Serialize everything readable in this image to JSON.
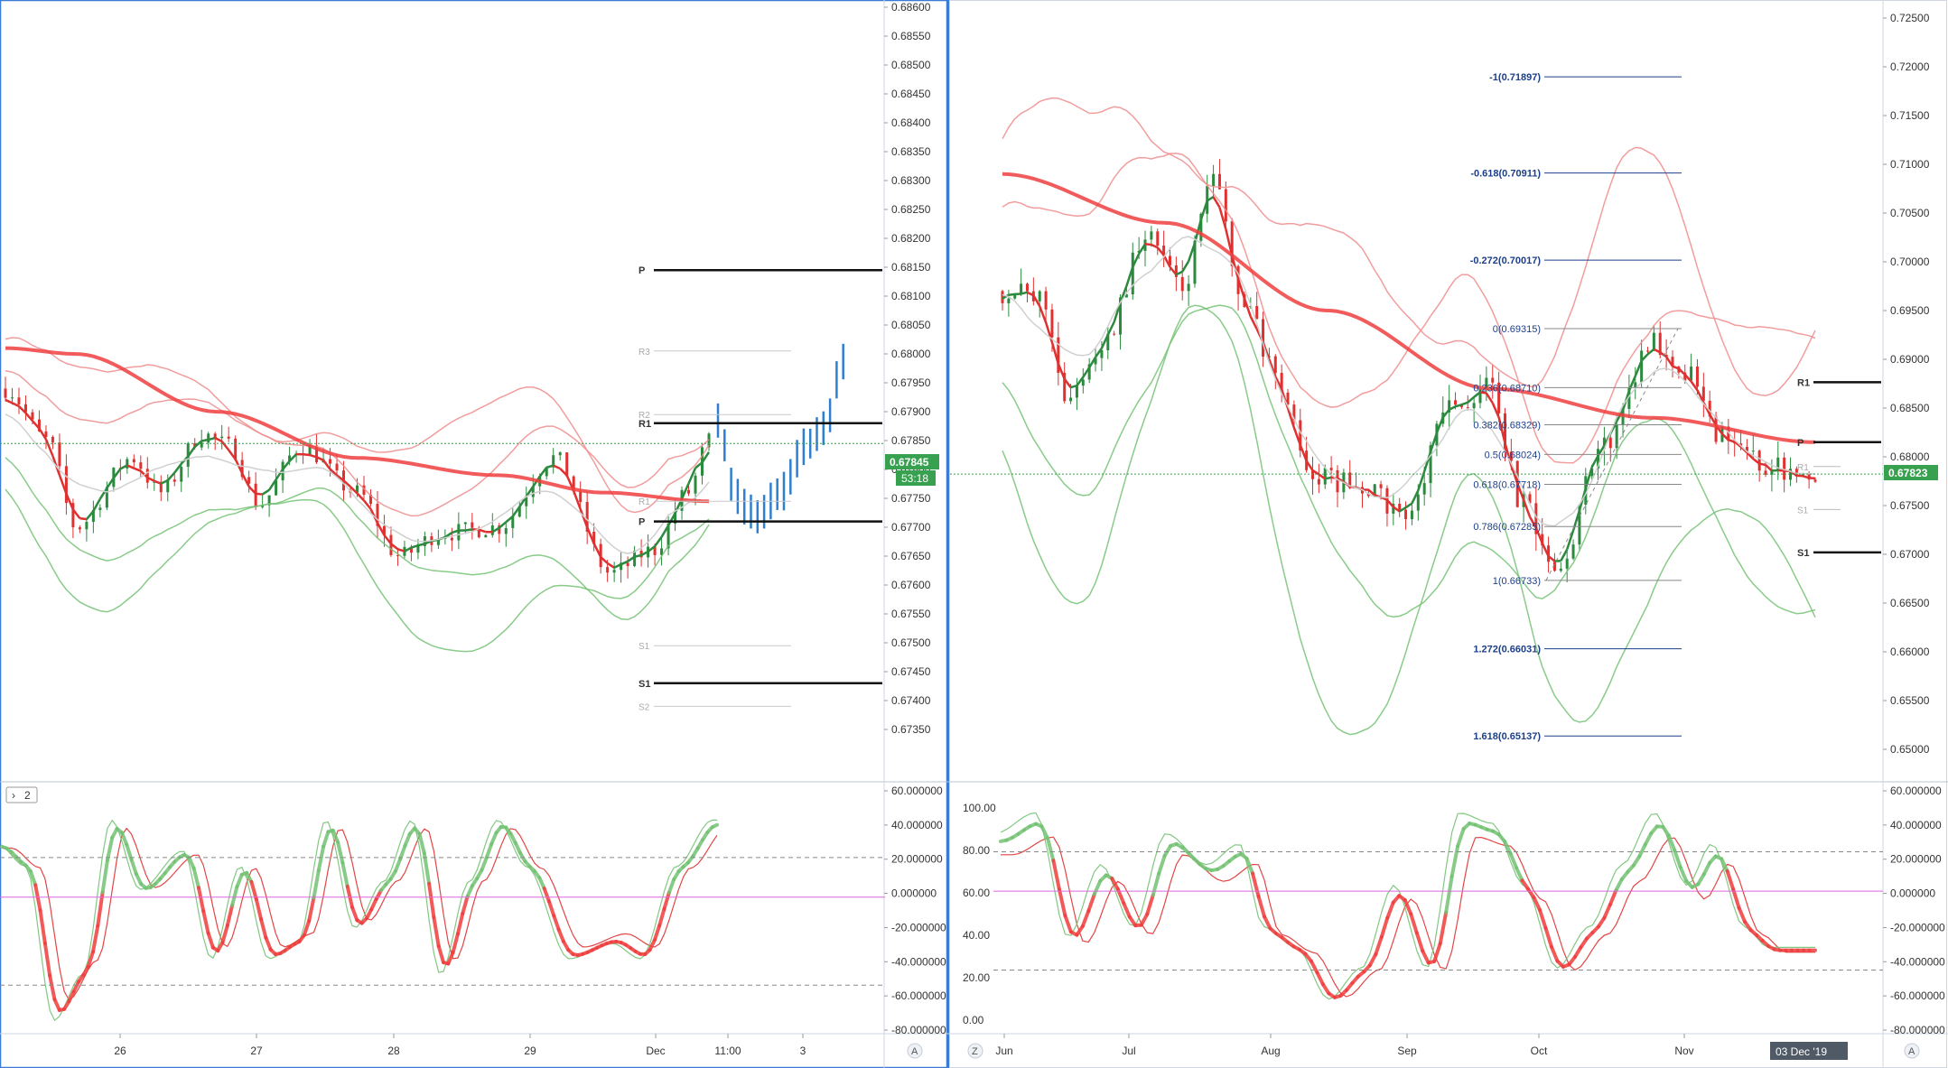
{
  "colors": {
    "up": "#2b8a3e",
    "down": "#e03131",
    "ema": "#f03e3e",
    "band_red": "#f08c8c",
    "band_green": "#74c274",
    "mid": "#d0d0d0",
    "forecast": "#2f7fd1",
    "pivot": "#111111",
    "fib": "#1c3f8a",
    "divider": "#3a7bd5",
    "price_tag": "#37a14f"
  },
  "left_chart": {
    "price_axis": [
      "0.68600",
      "0.68550",
      "0.68500",
      "0.68450",
      "0.68400",
      "0.68350",
      "0.68300",
      "0.68250",
      "0.68200",
      "0.68150",
      "0.68100",
      "0.68050",
      "0.68000",
      "0.67950",
      "0.67900",
      "0.67850",
      "0.67800",
      "0.67750",
      "0.67700",
      "0.67650",
      "0.67600",
      "0.67550",
      "0.67500",
      "0.67450",
      "0.67400",
      "0.67350"
    ],
    "current_price": "0.67845",
    "countdown": "53:18",
    "time_axis": [
      "26",
      "27",
      "28",
      "29",
      "Dec",
      "11:00",
      "3"
    ],
    "pivots": [
      {
        "label": "P",
        "value": 0.68145,
        "bold": true
      },
      {
        "label": "R3",
        "value": 0.68005,
        "bold": false
      },
      {
        "label": "R2",
        "value": 0.67895,
        "bold": false
      },
      {
        "label": "R1",
        "value": 0.6788,
        "bold": true
      },
      {
        "label": "R1",
        "value": 0.67745,
        "bold": false
      },
      {
        "label": "P",
        "value": 0.6771,
        "bold": true
      },
      {
        "label": "S1",
        "value": 0.67495,
        "bold": false
      },
      {
        "label": "S1",
        "value": 0.6743,
        "bold": true
      },
      {
        "label": "S2",
        "value": 0.6739,
        "bold": false
      }
    ],
    "indicator_axis": [
      "60.000000",
      "40.000000",
      "20.000000",
      "0.000000",
      "-20.000000",
      "-40.000000",
      "-60.000000",
      "-80.000000"
    ],
    "indicator_badge": "2"
  },
  "right_chart": {
    "price_axis": [
      "0.72500",
      "0.72000",
      "0.71500",
      "0.71000",
      "0.70500",
      "0.70000",
      "0.69500",
      "0.69000",
      "0.68500",
      "0.68000",
      "0.67500",
      "0.67000",
      "0.66500",
      "0.66000",
      "0.65500",
      "0.65000"
    ],
    "current_price": "0.67823",
    "time_axis": [
      "Jun",
      "Jul",
      "Aug",
      "Sep",
      "Oct",
      "Nov"
    ],
    "date_tag": "03 Dec '19",
    "fib_levels": [
      {
        "label": "-1(0.71897)",
        "value": 0.71897
      },
      {
        "label": "-0.618(0.70911)",
        "value": 0.70911
      },
      {
        "label": "-0.272(0.70017)",
        "value": 0.70017
      },
      {
        "label": "0(0.69315)",
        "value": 0.69315
      },
      {
        "label": "0.236(0.68710)",
        "value": 0.6871
      },
      {
        "label": "0.382(0.68329)",
        "value": 0.68329
      },
      {
        "label": "0.5(0.68024)",
        "value": 0.68024
      },
      {
        "label": "0.618(0.67718)",
        "value": 0.67718
      },
      {
        "label": "0.786(0.67285)",
        "value": 0.67285
      },
      {
        "label": "1(0.66733)",
        "value": 0.66733
      },
      {
        "label": "1.272(0.66031)",
        "value": 0.66031
      },
      {
        "label": "1.618(0.65137)",
        "value": 0.65137
      }
    ],
    "pivots": [
      {
        "label": "R1",
        "value": 0.68765,
        "bold": true
      },
      {
        "label": "P",
        "value": 0.6815,
        "bold": true
      },
      {
        "label": "R1",
        "value": 0.679,
        "bold": false
      },
      {
        "label": "S1",
        "value": 0.6746,
        "bold": false
      },
      {
        "label": "S1",
        "value": 0.6702,
        "bold": true
      }
    ],
    "indicator_left_axis": [
      "100.00",
      "80.00",
      "60.00",
      "40.00",
      "20.00",
      "0.00"
    ],
    "indicator_right_axis": [
      "60.000000",
      "40.000000",
      "20.000000",
      "0.000000",
      "-20.000000",
      "-40.000000",
      "-60.000000",
      "-80.000000"
    ]
  },
  "buttons": {
    "auto_left": "A",
    "auto_right": "A",
    "zoom": "Z"
  }
}
